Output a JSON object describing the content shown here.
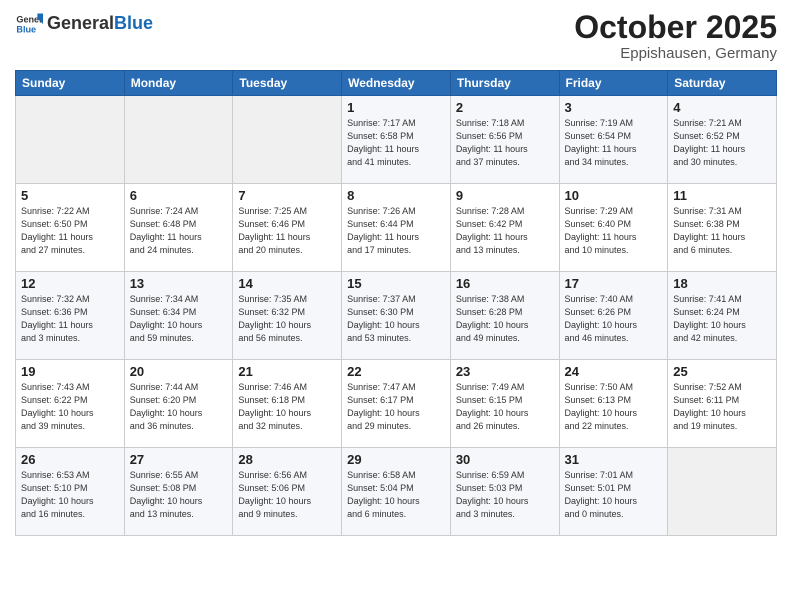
{
  "header": {
    "logo_general": "General",
    "logo_blue": "Blue",
    "month_title": "October 2025",
    "location": "Eppishausen, Germany"
  },
  "days_of_week": [
    "Sunday",
    "Monday",
    "Tuesday",
    "Wednesday",
    "Thursday",
    "Friday",
    "Saturday"
  ],
  "weeks": [
    [
      {
        "num": "",
        "info": ""
      },
      {
        "num": "",
        "info": ""
      },
      {
        "num": "",
        "info": ""
      },
      {
        "num": "1",
        "info": "Sunrise: 7:17 AM\nSunset: 6:58 PM\nDaylight: 11 hours\nand 41 minutes."
      },
      {
        "num": "2",
        "info": "Sunrise: 7:18 AM\nSunset: 6:56 PM\nDaylight: 11 hours\nand 37 minutes."
      },
      {
        "num": "3",
        "info": "Sunrise: 7:19 AM\nSunset: 6:54 PM\nDaylight: 11 hours\nand 34 minutes."
      },
      {
        "num": "4",
        "info": "Sunrise: 7:21 AM\nSunset: 6:52 PM\nDaylight: 11 hours\nand 30 minutes."
      }
    ],
    [
      {
        "num": "5",
        "info": "Sunrise: 7:22 AM\nSunset: 6:50 PM\nDaylight: 11 hours\nand 27 minutes."
      },
      {
        "num": "6",
        "info": "Sunrise: 7:24 AM\nSunset: 6:48 PM\nDaylight: 11 hours\nand 24 minutes."
      },
      {
        "num": "7",
        "info": "Sunrise: 7:25 AM\nSunset: 6:46 PM\nDaylight: 11 hours\nand 20 minutes."
      },
      {
        "num": "8",
        "info": "Sunrise: 7:26 AM\nSunset: 6:44 PM\nDaylight: 11 hours\nand 17 minutes."
      },
      {
        "num": "9",
        "info": "Sunrise: 7:28 AM\nSunset: 6:42 PM\nDaylight: 11 hours\nand 13 minutes."
      },
      {
        "num": "10",
        "info": "Sunrise: 7:29 AM\nSunset: 6:40 PM\nDaylight: 11 hours\nand 10 minutes."
      },
      {
        "num": "11",
        "info": "Sunrise: 7:31 AM\nSunset: 6:38 PM\nDaylight: 11 hours\nand 6 minutes."
      }
    ],
    [
      {
        "num": "12",
        "info": "Sunrise: 7:32 AM\nSunset: 6:36 PM\nDaylight: 11 hours\nand 3 minutes."
      },
      {
        "num": "13",
        "info": "Sunrise: 7:34 AM\nSunset: 6:34 PM\nDaylight: 10 hours\nand 59 minutes."
      },
      {
        "num": "14",
        "info": "Sunrise: 7:35 AM\nSunset: 6:32 PM\nDaylight: 10 hours\nand 56 minutes."
      },
      {
        "num": "15",
        "info": "Sunrise: 7:37 AM\nSunset: 6:30 PM\nDaylight: 10 hours\nand 53 minutes."
      },
      {
        "num": "16",
        "info": "Sunrise: 7:38 AM\nSunset: 6:28 PM\nDaylight: 10 hours\nand 49 minutes."
      },
      {
        "num": "17",
        "info": "Sunrise: 7:40 AM\nSunset: 6:26 PM\nDaylight: 10 hours\nand 46 minutes."
      },
      {
        "num": "18",
        "info": "Sunrise: 7:41 AM\nSunset: 6:24 PM\nDaylight: 10 hours\nand 42 minutes."
      }
    ],
    [
      {
        "num": "19",
        "info": "Sunrise: 7:43 AM\nSunset: 6:22 PM\nDaylight: 10 hours\nand 39 minutes."
      },
      {
        "num": "20",
        "info": "Sunrise: 7:44 AM\nSunset: 6:20 PM\nDaylight: 10 hours\nand 36 minutes."
      },
      {
        "num": "21",
        "info": "Sunrise: 7:46 AM\nSunset: 6:18 PM\nDaylight: 10 hours\nand 32 minutes."
      },
      {
        "num": "22",
        "info": "Sunrise: 7:47 AM\nSunset: 6:17 PM\nDaylight: 10 hours\nand 29 minutes."
      },
      {
        "num": "23",
        "info": "Sunrise: 7:49 AM\nSunset: 6:15 PM\nDaylight: 10 hours\nand 26 minutes."
      },
      {
        "num": "24",
        "info": "Sunrise: 7:50 AM\nSunset: 6:13 PM\nDaylight: 10 hours\nand 22 minutes."
      },
      {
        "num": "25",
        "info": "Sunrise: 7:52 AM\nSunset: 6:11 PM\nDaylight: 10 hours\nand 19 minutes."
      }
    ],
    [
      {
        "num": "26",
        "info": "Sunrise: 6:53 AM\nSunset: 5:10 PM\nDaylight: 10 hours\nand 16 minutes."
      },
      {
        "num": "27",
        "info": "Sunrise: 6:55 AM\nSunset: 5:08 PM\nDaylight: 10 hours\nand 13 minutes."
      },
      {
        "num": "28",
        "info": "Sunrise: 6:56 AM\nSunset: 5:06 PM\nDaylight: 10 hours\nand 9 minutes."
      },
      {
        "num": "29",
        "info": "Sunrise: 6:58 AM\nSunset: 5:04 PM\nDaylight: 10 hours\nand 6 minutes."
      },
      {
        "num": "30",
        "info": "Sunrise: 6:59 AM\nSunset: 5:03 PM\nDaylight: 10 hours\nand 3 minutes."
      },
      {
        "num": "31",
        "info": "Sunrise: 7:01 AM\nSunset: 5:01 PM\nDaylight: 10 hours\nand 0 minutes."
      },
      {
        "num": "",
        "info": ""
      }
    ]
  ]
}
